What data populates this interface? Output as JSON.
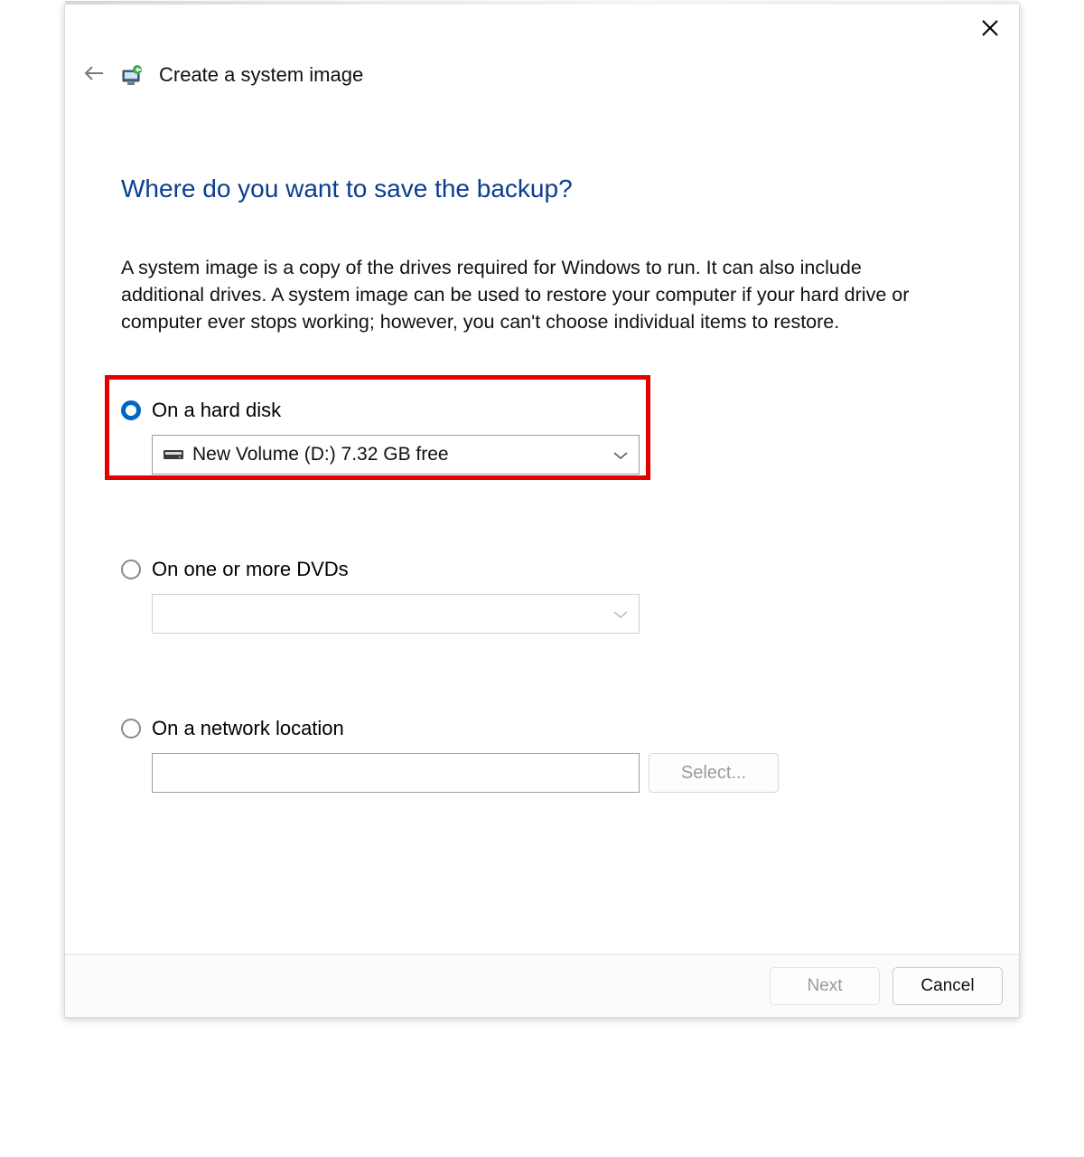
{
  "window": {
    "title": "Create a system image"
  },
  "page": {
    "heading": "Where do you want to save the backup?",
    "description": "A system image is a copy of the drives required for Windows to run. It can also include additional drives. A system image can be used to restore your computer if your hard drive or computer ever stops working; however, you can't choose individual items to restore."
  },
  "options": {
    "hard_disk": {
      "label": "On a hard disk",
      "selected": true,
      "drive_display": "New Volume (D:)  7.32 GB free"
    },
    "dvds": {
      "label": "On one or more DVDs",
      "selected": false,
      "drive_display": ""
    },
    "network": {
      "label": "On a network location",
      "selected": false,
      "path": "",
      "select_button": "Select..."
    }
  },
  "footer": {
    "next": "Next",
    "cancel": "Cancel"
  }
}
